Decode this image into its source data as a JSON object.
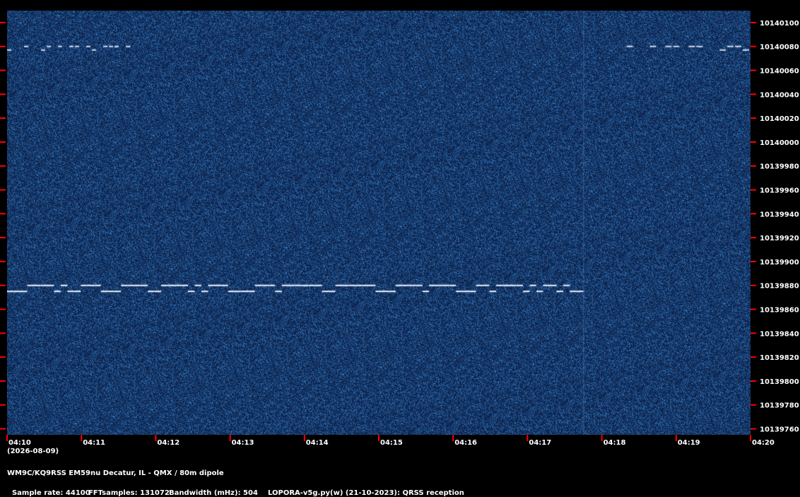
{
  "chart_data": {
    "type": "heatmap",
    "title": "",
    "xlabel": "",
    "ylabel": "",
    "x_ticks": [
      "04:10",
      "04:11",
      "04:12",
      "04:13",
      "04:14",
      "04:15",
      "04:16",
      "04:17",
      "04:18",
      "04:19",
      "04:20"
    ],
    "x_range": [
      "04:10",
      "04:20"
    ],
    "date_label": "(2026-08-09)",
    "y_ticks": [
      10140100,
      10140080,
      10140060,
      10140040,
      10140020,
      10140000,
      10139980,
      10139960,
      10139940,
      10139920,
      10139900,
      10139880,
      10139860,
      10139840,
      10139820,
      10139800,
      10139780,
      10139760
    ],
    "y_range": [
      10139755,
      10140110
    ],
    "colormap": [
      "#0b1a44",
      "#123a86",
      "#ffffff"
    ],
    "signals": [
      {
        "note": "FSK carrier",
        "base_hz": 10139875,
        "shift_hz": 5,
        "start": "04:10",
        "end": "04:17:45",
        "pattern": [
          0,
          0,
          0,
          1,
          1,
          1,
          1,
          0,
          1,
          0,
          0,
          1,
          1,
          1,
          0,
          0,
          0,
          1,
          1,
          1,
          1,
          0,
          0,
          1,
          1,
          1,
          1,
          0,
          1,
          0,
          1,
          1,
          1,
          0,
          0,
          0,
          0,
          1,
          1,
          1,
          0,
          1,
          1,
          1,
          1,
          1,
          1,
          0,
          0,
          1,
          1,
          1,
          1,
          1,
          1,
          0,
          0,
          0,
          1,
          1,
          1,
          1,
          0,
          1,
          1,
          1,
          1,
          0,
          0,
          0,
          1,
          1,
          0,
          1,
          1,
          1,
          1,
          0,
          1,
          0,
          1,
          1,
          0,
          1,
          0,
          0
        ]
      },
      {
        "note": "weak FSK upper",
        "base_hz": 10140077,
        "shift_hz": 3,
        "start": "04:10",
        "end": "04:11:45",
        "pattern": [
          0,
          0,
          0,
          1,
          0,
          0,
          0,
          1,
          0,
          1,
          0,
          1,
          1,
          0,
          1,
          0,
          0,
          1,
          1,
          1,
          0,
          1,
          0
        ]
      },
      {
        "note": "weak FSK upper right",
        "base_hz": 10140077,
        "shift_hz": 3,
        "start": "04:18:20",
        "end": "04:20",
        "pattern": [
          1,
          0,
          0,
          1,
          0,
          1,
          1,
          0,
          1,
          1,
          0,
          0,
          0,
          1,
          1,
          0
        ]
      }
    ]
  },
  "footer": {
    "title": "WM9C/KQ9RSS EM59nu Decatur, IL - QMX / 80m dipole",
    "sample_rate": "Sample rate: 44100",
    "fft_samples": "FFTsamples: 131072",
    "bandwidth": "Bandwidth (mHz): 504",
    "software": "LOPORA-v5g.py(w) (21-10-2023): QRSS reception"
  },
  "colors": {
    "background": "#000000",
    "tick_mark": "#ff0000",
    "label": "#ffffff"
  }
}
